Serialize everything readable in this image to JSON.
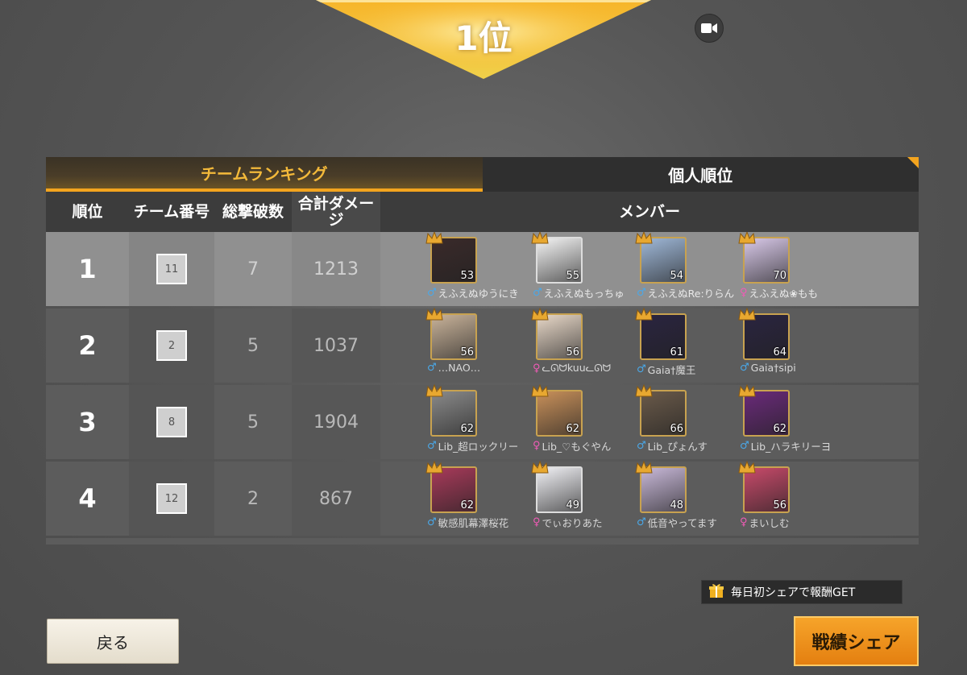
{
  "result": {
    "rank_label": "1位"
  },
  "tabs": [
    {
      "label": "チームランキング",
      "active": true
    },
    {
      "label": "個人順位",
      "active": false
    }
  ],
  "table": {
    "headers": {
      "rank": "順位",
      "team": "チーム番号",
      "kills": "総撃破数",
      "damage": "合計ダメージ",
      "members": "メンバー"
    },
    "rows": [
      {
        "rank": "1",
        "team": "11",
        "kills": "7",
        "damage": "1213",
        "members": [
          {
            "name": "えふえぬゆうにき",
            "level": "53",
            "gender": "male",
            "avatar_color": "#3a2a2a"
          },
          {
            "name": "えふえぬもっちゅ",
            "level": "55",
            "gender": "male",
            "avatar_color": "#f4f4f4"
          },
          {
            "name": "えふえぬRe:りらん",
            "level": "54",
            "gender": "male",
            "avatar_color": "#9fb8d8"
          },
          {
            "name": "えふえぬ❀もも",
            "level": "70",
            "gender": "female",
            "avatar_color": "#d8c8e8"
          }
        ]
      },
      {
        "rank": "2",
        "team": "2",
        "kills": "5",
        "damage": "1037",
        "members": [
          {
            "name": "…NAO…",
            "level": "56",
            "gender": "male",
            "avatar_color": "#c9b39a"
          },
          {
            "name": "ᓚᘏᗢkuuᓚᘏᗢ",
            "level": "56",
            "gender": "female",
            "avatar_color": "#e8d8c8"
          },
          {
            "name": "Gaia†魔王",
            "level": "61",
            "gender": "male",
            "avatar_color": "#2a2440"
          },
          {
            "name": "Gaia†sipi",
            "level": "64",
            "gender": "male",
            "avatar_color": "#2a2440"
          }
        ]
      },
      {
        "rank": "3",
        "team": "8",
        "kills": "5",
        "damage": "1904",
        "members": [
          {
            "name": "Lib_超ロックリー",
            "level": "62",
            "gender": "male",
            "avatar_color": "#8a8a8a"
          },
          {
            "name": "Lib_♡もぐやん",
            "level": "62",
            "gender": "female",
            "avatar_color": "#c8905a"
          },
          {
            "name": "Lib_ぴょんす",
            "level": "66",
            "gender": "male",
            "avatar_color": "#6a5a4a"
          },
          {
            "name": "Lib_ハラキリーヨ",
            "level": "62",
            "gender": "male",
            "avatar_color": "#6a2a7a"
          }
        ]
      },
      {
        "rank": "4",
        "team": "12",
        "kills": "2",
        "damage": "867",
        "members": [
          {
            "name": "敏感肌幕澤桜花",
            "level": "62",
            "gender": "male",
            "avatar_color": "#a83a5a"
          },
          {
            "name": "でぃおりあた",
            "level": "49",
            "gender": "female",
            "avatar_color": "#f0f0f4"
          },
          {
            "name": "低音やってます",
            "level": "48",
            "gender": "male",
            "avatar_color": "#c8b8d8"
          },
          {
            "name": "まいしむ",
            "level": "56",
            "gender": "female",
            "avatar_color": "#c84a6a"
          }
        ]
      }
    ]
  },
  "footer": {
    "back_label": "戻る",
    "promo_label": "毎日初シェアで報酬GET",
    "share_label": "戦績シェア"
  },
  "colors": {
    "accent": "#f3a41e",
    "male": "#4aa8e8",
    "female": "#f05bb7"
  },
  "icons": {
    "record": "video-camera-icon",
    "gift": "gift-icon",
    "crown": "crown-icon"
  }
}
